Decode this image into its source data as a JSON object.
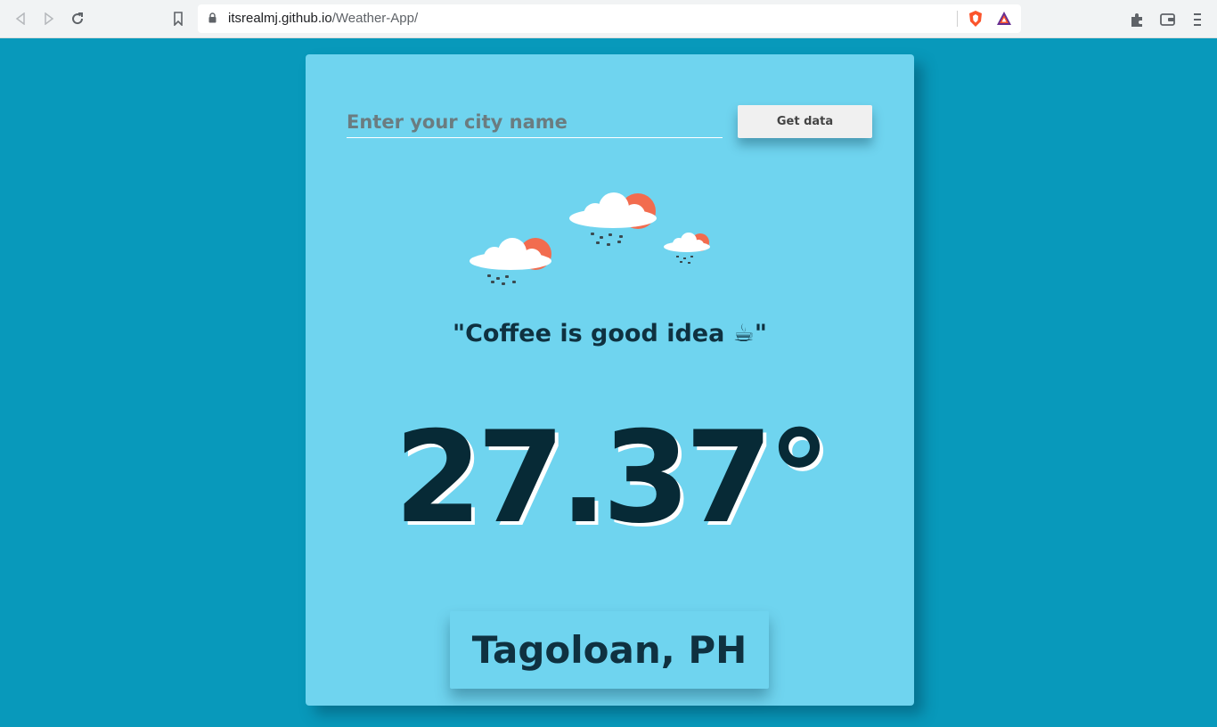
{
  "browser": {
    "url_host": "itsrealmj.github.io",
    "url_path": "/Weather-App/"
  },
  "app": {
    "city_placeholder": "Enter your city name",
    "get_button": "Get data",
    "quote": "\"Coffee is good idea ☕\"",
    "temperature": "27.37°",
    "location": "Tagoloan, PH"
  },
  "colors": {
    "page_bg": "#0899bb",
    "card_bg": "#6fd4ef",
    "text_dark": "#0f3140"
  }
}
